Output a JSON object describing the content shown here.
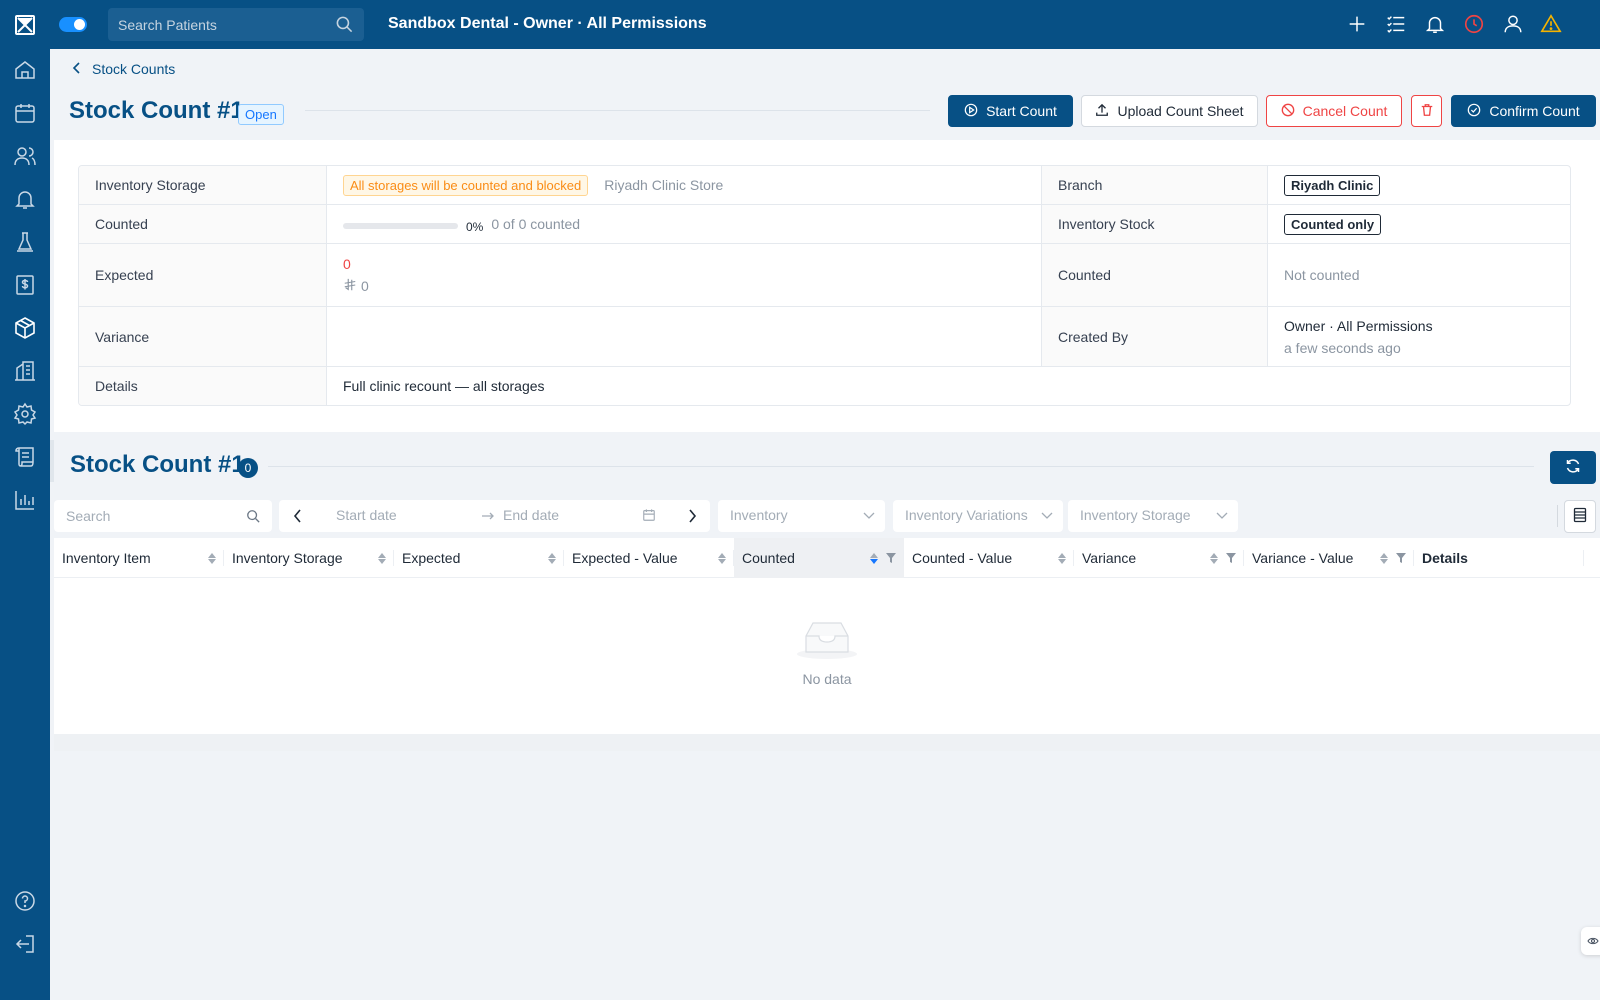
{
  "app": {
    "title": "Sandbox Dental - Owner · All Permissions",
    "search_placeholder": "Search Patients"
  },
  "sidebar": {
    "items": [
      {
        "icon": "home-icon"
      },
      {
        "icon": "calendar-icon"
      },
      {
        "icon": "patients-icon"
      },
      {
        "icon": "bell-icon"
      },
      {
        "icon": "lab-icon"
      },
      {
        "icon": "billing-icon"
      },
      {
        "icon": "inventory-box-icon"
      },
      {
        "icon": "clinic-building-icon"
      },
      {
        "icon": "settings-icon"
      },
      {
        "icon": "ledger-icon"
      },
      {
        "icon": "reports-chart-icon"
      }
    ],
    "bottom": [
      {
        "icon": "help-icon"
      },
      {
        "icon": "logout-icon"
      }
    ]
  },
  "breadcrumb": {
    "back_label": "Stock Counts"
  },
  "header": {
    "title": "Stock Count #1",
    "status": "Open",
    "buttons": {
      "start": "Start Count",
      "upload": "Upload Count Sheet",
      "cancel": "Cancel Count",
      "confirm": "Confirm Count"
    }
  },
  "info": {
    "inventory_storage_label": "Inventory Storage",
    "inventory_storage_tag": "All storages will be counted and blocked",
    "inventory_storage_value": "Riyadh Clinic Store",
    "branch_label": "Branch",
    "branch_value": "Riyadh Clinic",
    "counted_label": "Counted",
    "counted_percent_text": "0%",
    "counted_progress": 0,
    "counted_text": "0 of 0 counted",
    "inventory_stock_label": "Inventory Stock",
    "inventory_stock_value": "Counted only",
    "expected_label": "Expected",
    "expected_qty": "0",
    "expected_currency_value": "0",
    "counted2_label": "Counted",
    "counted2_value": "Not counted",
    "variance_label": "Variance",
    "variance_value": "",
    "created_by_label": "Created By",
    "created_by_name": "Owner · All Permissions",
    "created_by_time": "a few seconds ago",
    "details_label": "Details",
    "details_value": "Full clinic recount — all storages"
  },
  "section": {
    "title": "Stock Count #1",
    "count": "0"
  },
  "filters": {
    "search_placeholder": "Search",
    "start_date_placeholder": "Start date",
    "end_date_placeholder": "End date",
    "inventory": "Inventory",
    "inventory_variations": "Inventory Variations",
    "inventory_storage": "Inventory Storage"
  },
  "table": {
    "columns": [
      "Inventory Item",
      "Inventory Storage",
      "Expected",
      "Expected - Value",
      "Counted",
      "Counted - Value",
      "Variance",
      "Variance - Value",
      "Details"
    ],
    "empty_text": "No data"
  },
  "colors": {
    "brand": "#075085",
    "accent": "#1890ff",
    "danger": "#ef4444",
    "warning": "#fa8c16"
  }
}
